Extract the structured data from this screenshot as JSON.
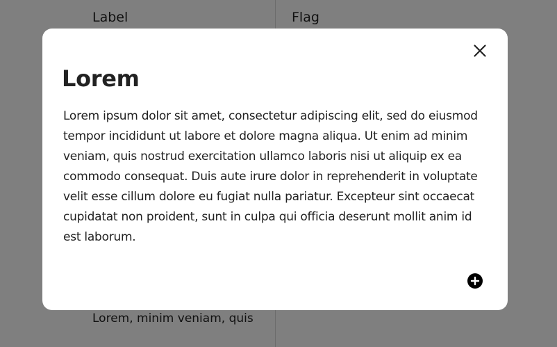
{
  "background": {
    "headers": [
      "Label",
      "Flag"
    ],
    "cell_text": "Lorem, minim veniam, quis"
  },
  "modal": {
    "title": "Lorem",
    "body": "Lorem ipsum dolor sit amet, consectetur adipiscing elit, sed do eiusmod tempor incididunt ut labore et dolore magna aliqua. Ut enim ad minim veniam, quis nostrud exercitation ullamco laboris nisi ut aliquip ex ea commodo consequat. Duis aute irure dolor in reprehenderit in voluptate velit esse cillum dolore eu fugiat nulla pariatur. Excepteur sint occaecat cupidatat non proident, sunt in culpa qui officia deserunt mollit anim id est laborum.",
    "close_icon": "close-icon",
    "add_icon": "plus-circle-icon"
  },
  "colors": {
    "overlay": "#000000",
    "modal_bg": "#ffffff",
    "text": "#222222"
  }
}
